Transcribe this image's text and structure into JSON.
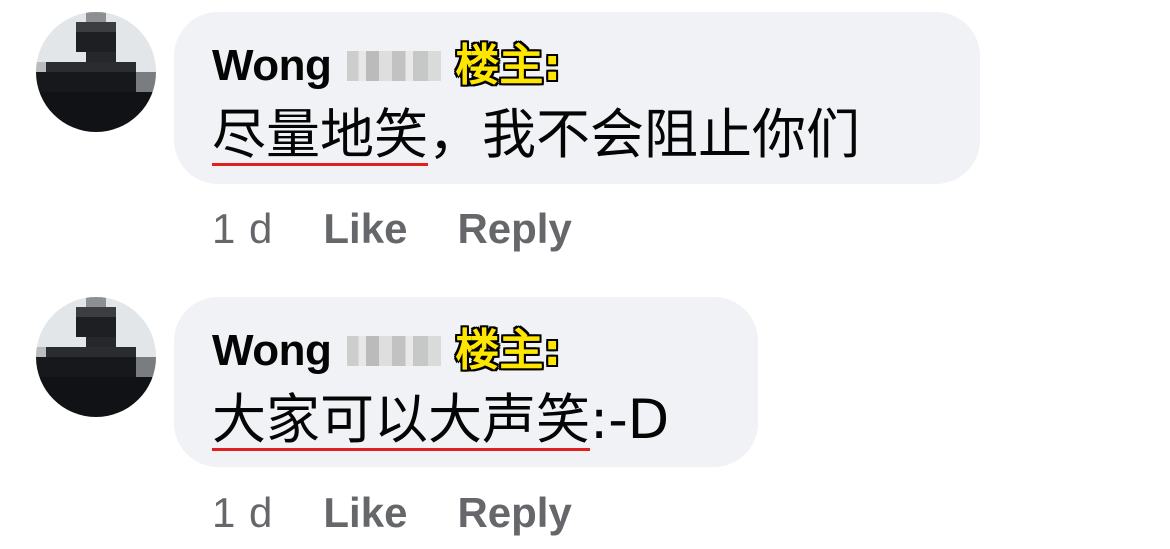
{
  "comments": [
    {
      "author_name": "Wong",
      "op_tag": "楼主:",
      "text_underlined": "尽量地笑",
      "text_rest": "，我不会阻止你们",
      "time_ago": "1 d",
      "like_label": "Like",
      "reply_label": "Reply"
    },
    {
      "author_name": "Wong",
      "op_tag": "楼主:",
      "text_underlined": "大家可以大声笑",
      "text_rest": ":-D",
      "time_ago": "1 d",
      "like_label": "Like",
      "reply_label": "Reply"
    }
  ],
  "colors": {
    "bubble_bg": "#f0f2f5",
    "text": "#050505",
    "meta": "#65676b",
    "op_tag": "#ffe600",
    "underline": "#e02020"
  },
  "icons": {
    "avatar": "pixelated-avatar"
  }
}
